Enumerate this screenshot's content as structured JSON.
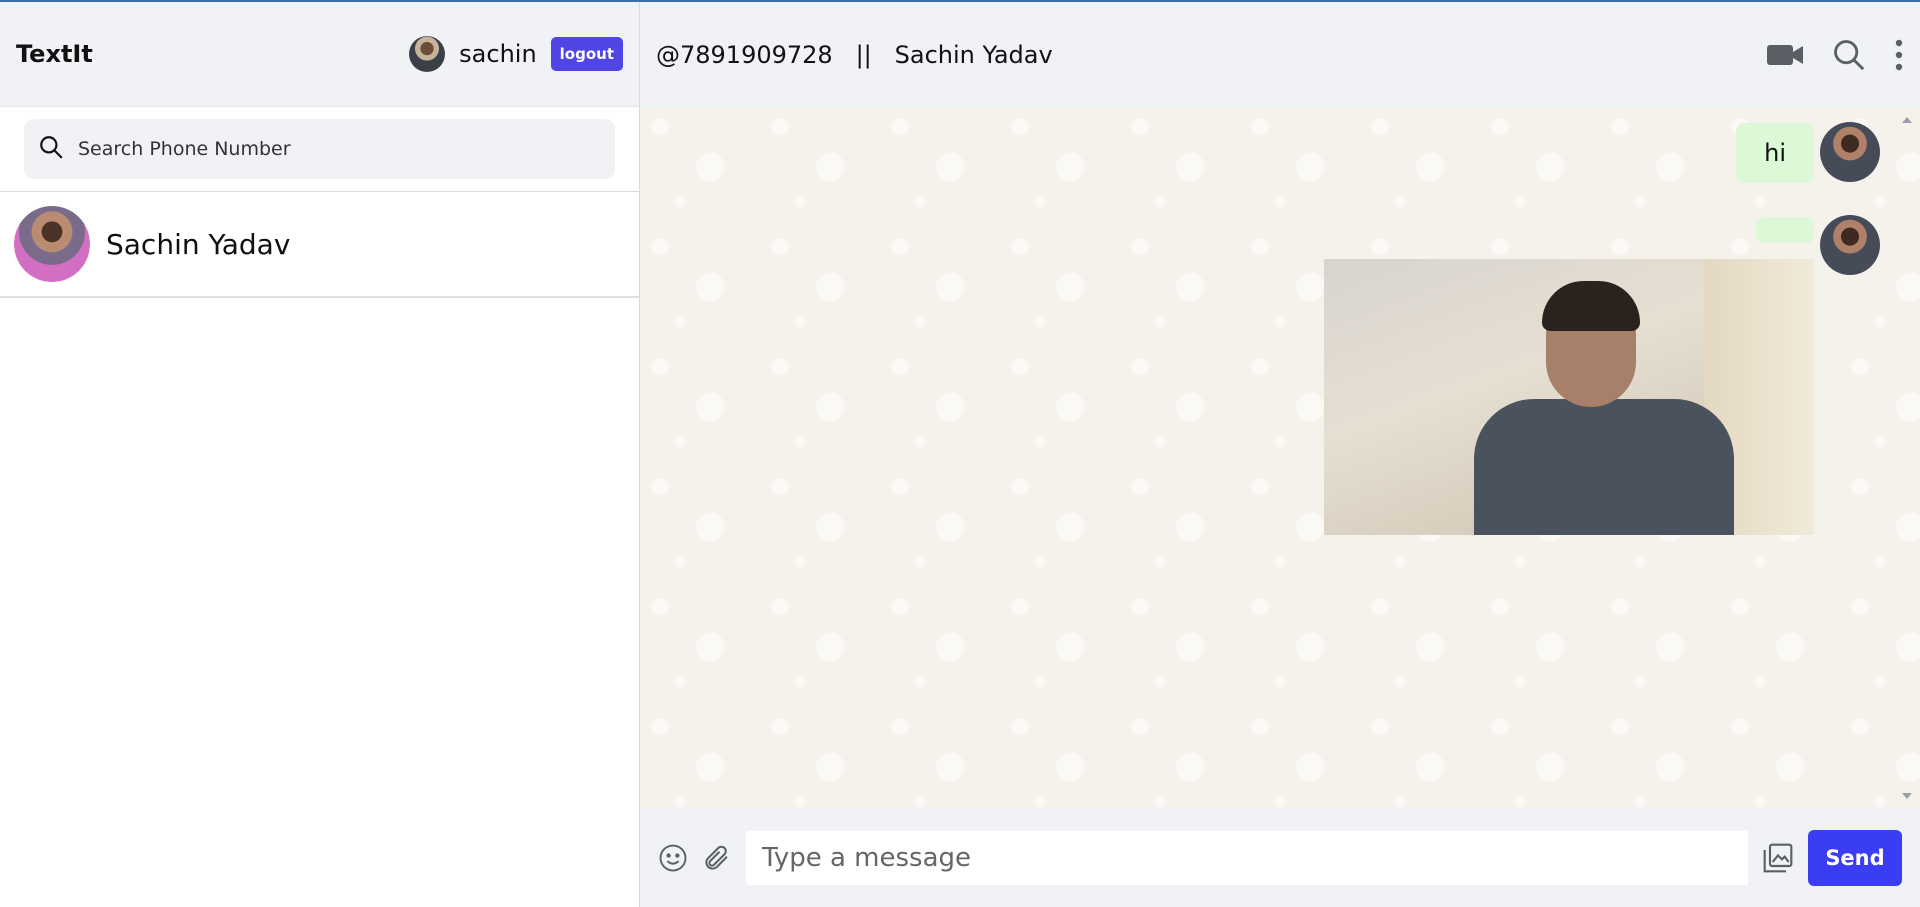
{
  "app": {
    "name": "TextIt"
  },
  "user": {
    "name": "sachin",
    "logout_label": "logout"
  },
  "search": {
    "placeholder": "Search Phone Number"
  },
  "contacts": [
    {
      "name": "Sachin Yadav"
    }
  ],
  "chat_header": {
    "title": "@7891909728   ||   Sachin Yadav"
  },
  "messages": [
    {
      "type": "text",
      "text": "hi",
      "outgoing": true
    },
    {
      "type": "image",
      "text": "",
      "outgoing": true
    }
  ],
  "composer": {
    "placeholder": "Type a message",
    "send_label": "Send"
  },
  "colors": {
    "accent": "#3b3df2",
    "logout": "#5046e6",
    "bubble": "#dcf8d6",
    "header_bg": "#f0f2f5",
    "chat_bg": "#f5f2eb"
  },
  "icons": [
    "search-icon",
    "video-icon",
    "search-icon",
    "more-vertical-icon",
    "emoji-icon",
    "attachment-icon",
    "gallery-icon"
  ]
}
